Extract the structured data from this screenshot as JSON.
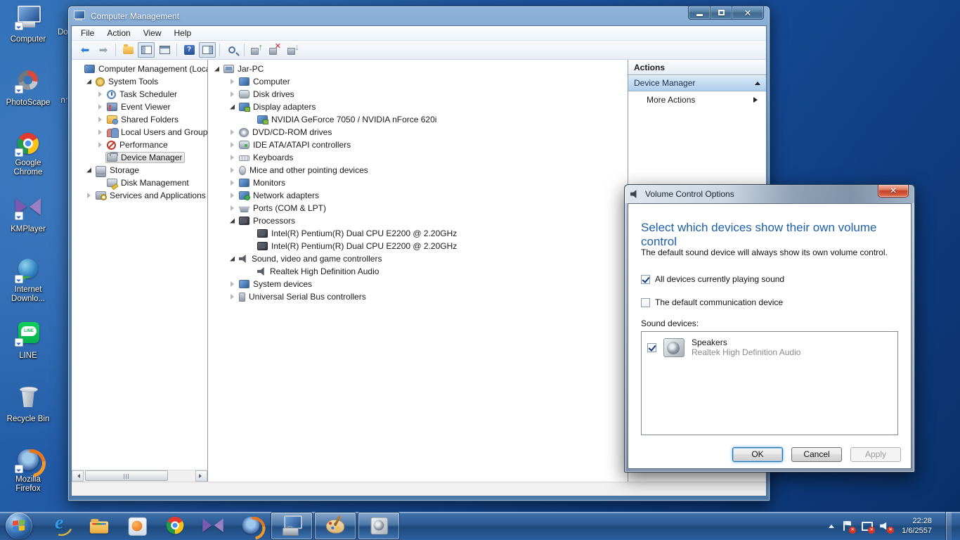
{
  "desktop": {
    "icons": [
      {
        "label": "Computer",
        "icon": "di-computer has-arrow",
        "iconname": "computer-icon",
        "name": "desktop-icon-computer"
      },
      {
        "label": "PhotoScape",
        "icon": "di-photoscape has-arrow",
        "iconname": "photoscape-icon",
        "name": "desktop-icon-photoscape"
      },
      {
        "label": "Google Chrome",
        "icon": "di-chrome has-arrow",
        "iconname": "chrome-icon",
        "name": "desktop-icon-google-chrome"
      },
      {
        "label": "KMPlayer",
        "icon": "di-km has-arrow",
        "iconname": "kmplayer-icon",
        "name": "desktop-icon-kmplayer"
      },
      {
        "label": "Internet Downlo...",
        "icon": "di-idm has-arrow",
        "iconname": "idm-icon",
        "name": "desktop-icon-internet-download-manager"
      },
      {
        "label": "LINE",
        "icon": "di-line has-arrow",
        "iconname": "line-icon",
        "name": "desktop-icon-line"
      },
      {
        "label": "Recycle Bin",
        "icon": "di-recycle",
        "iconname": "recycle-bin-icon",
        "name": "desktop-icon-recycle-bin"
      },
      {
        "label": "Mozilla Firefox",
        "icon": "di-firefox has-arrow",
        "iconname": "firefox-icon",
        "name": "desktop-icon-mozilla-firefox"
      }
    ],
    "partial_labels": {
      "top": "Do",
      "bottom": "กา"
    }
  },
  "window": {
    "title": "Computer Management",
    "menus": [
      {
        "label": "File",
        "name": "menu-file"
      },
      {
        "label": "Action",
        "name": "menu-action"
      },
      {
        "label": "View",
        "name": "menu-view"
      },
      {
        "label": "Help",
        "name": "menu-help"
      }
    ],
    "toolbar": [
      {
        "cls": "tbtn",
        "icon": "tb-back",
        "name": "toolbar-back-button",
        "ia": "true"
      },
      {
        "cls": "tbtn",
        "icon": "tb-fwd",
        "name": "toolbar-forward-button",
        "ia": "true"
      },
      {
        "cls": "tb-sep",
        "name": "toolbar-separator",
        "ia": "false"
      },
      {
        "cls": "tbtn",
        "icon": "tb-folder",
        "name": "toolbar-export-list-button",
        "ia": "true"
      },
      {
        "cls": "tbtn pressed",
        "icon": "tb-winL",
        "name": "toolbar-show-console-tree-button",
        "ia": "true"
      },
      {
        "cls": "tbtn",
        "icon": "tb-props",
        "name": "toolbar-properties-button",
        "ia": "true"
      },
      {
        "cls": "tb-sep",
        "name": "toolbar-separator",
        "ia": "false"
      },
      {
        "cls": "tbtn",
        "icon": "tb-help",
        "name": "toolbar-help-button",
        "ia": "true"
      },
      {
        "cls": "tbtn pressed",
        "icon": "tb-winR",
        "name": "toolbar-show-action-pane-button",
        "ia": "true"
      },
      {
        "cls": "tb-sep",
        "name": "toolbar-separator",
        "ia": "false"
      },
      {
        "cls": "tbtn",
        "icon": "tb-scan",
        "name": "toolbar-scan-hardware-changes-button",
        "ia": "true"
      },
      {
        "cls": "tb-sep",
        "name": "toolbar-separator",
        "ia": "false"
      },
      {
        "cls": "tbtn",
        "icon": "tb-chip tb-up",
        "name": "toolbar-update-driver-button",
        "ia": "true"
      },
      {
        "cls": "tbtn",
        "icon": "tb-chip tb-del",
        "name": "toolbar-uninstall-device-button",
        "ia": "true"
      },
      {
        "cls": "tbtn",
        "icon": "tb-chip tb-dis",
        "name": "toolbar-disable-device-button",
        "ia": "true"
      }
    ],
    "console_tree": [
      {
        "label": "Computer Management (Local",
        "cls": "ind0",
        "arrow": "noarrow",
        "icon": "ic-cmgmt",
        "iconname": "computer-management-icon",
        "name": "tree-item-computer-management"
      },
      {
        "label": "System Tools",
        "cls": "ind1",
        "arrow": "expanded",
        "icon": "ic-systools",
        "iconname": "system-tools-icon",
        "name": "tree-item-system-tools"
      },
      {
        "label": "Task Scheduler",
        "cls": "ind2",
        "arrow": "collapsed",
        "icon": "ic-task",
        "iconname": "task-scheduler-icon",
        "name": "tree-item-task-scheduler"
      },
      {
        "label": "Event Viewer",
        "cls": "ind2",
        "arrow": "collapsed",
        "icon": "ic-event",
        "iconname": "event-viewer-icon",
        "name": "tree-item-event-viewer"
      },
      {
        "label": "Shared Folders",
        "cls": "ind2",
        "arrow": "collapsed",
        "icon": "ic-shared",
        "iconname": "shared-folders-icon",
        "name": "tree-item-shared-folders"
      },
      {
        "label": "Local Users and Groups",
        "cls": "ind2",
        "arrow": "collapsed",
        "icon": "ic-users",
        "iconname": "local-users-groups-icon",
        "name": "tree-item-local-users-and-groups"
      },
      {
        "label": "Performance",
        "cls": "ind2",
        "arrow": "collapsed",
        "icon": "ic-perf",
        "iconname": "performance-icon",
        "name": "tree-item-performance"
      },
      {
        "label": "Device Manager",
        "cls": "ind2 selected",
        "arrow": "noarrow",
        "icon": "ic-devmgr",
        "iconname": "device-manager-icon",
        "name": "tree-item-device-manager"
      },
      {
        "label": "Storage",
        "cls": "ind1",
        "arrow": "expanded",
        "icon": "ic-storage",
        "iconname": "storage-icon",
        "name": "tree-item-storage"
      },
      {
        "label": "Disk Management",
        "cls": "ind2",
        "arrow": "noarrow",
        "icon": "ic-diskmgmt",
        "iconname": "disk-management-icon",
        "name": "tree-item-disk-management"
      },
      {
        "label": "Services and Applications",
        "cls": "ind1",
        "arrow": "collapsed",
        "icon": "ic-services",
        "iconname": "services-applications-icon",
        "name": "tree-item-services-and-applications"
      }
    ],
    "device_tree": [
      {
        "label": "Jar-PC",
        "cls": "ind0",
        "arrow": "expanded",
        "icon": "ic-pcroot",
        "iconname": "computer-root-icon",
        "name": "device-item-jar-pc"
      },
      {
        "label": "Computer",
        "cls": "ind1",
        "arrow": "collapsed",
        "icon": "ic-computer",
        "iconname": "computer-category-icon",
        "name": "device-item-computer"
      },
      {
        "label": "Disk drives",
        "cls": "ind1",
        "arrow": "collapsed",
        "icon": "ic-disk",
        "iconname": "disk-drives-icon",
        "name": "device-item-disk-drives"
      },
      {
        "label": "Display adapters",
        "cls": "ind1",
        "arrow": "expanded",
        "icon": "ic-display",
        "iconname": "display-adapters-icon",
        "name": "device-item-display-adapters"
      },
      {
        "label": "NVIDIA GeForce 7050 / NVIDIA nForce 620i",
        "cls": "ind2",
        "arrow": "noarrow",
        "icon": "ic-display",
        "iconname": "display-adapter-icon",
        "name": "device-item-nvidia-geforce-7050"
      },
      {
        "label": "DVD/CD-ROM drives",
        "cls": "ind1",
        "arrow": "collapsed",
        "icon": "ic-dvd",
        "iconname": "dvd-cdrom-icon",
        "name": "device-item-dvd-cd-rom-drives"
      },
      {
        "label": "IDE ATA/ATAPI controllers",
        "cls": "ind1",
        "arrow": "collapsed",
        "icon": "ic-ide",
        "iconname": "ide-controllers-icon",
        "name": "device-item-ide-ata-atapi-controllers"
      },
      {
        "label": "Keyboards",
        "cls": "ind1",
        "arrow": "collapsed",
        "icon": "ic-keyboard",
        "iconname": "keyboards-icon",
        "name": "device-item-keyboards"
      },
      {
        "label": "Mice and other pointing devices",
        "cls": "ind1",
        "arrow": "collapsed",
        "icon": "ic-mouse",
        "iconname": "mice-icon",
        "name": "device-item-mice"
      },
      {
        "label": "Monitors",
        "cls": "ind1",
        "arrow": "collapsed",
        "icon": "ic-monitor",
        "iconname": "monitors-icon",
        "name": "device-item-monitors"
      },
      {
        "label": "Network adapters",
        "cls": "ind1",
        "arrow": "collapsed",
        "icon": "ic-network",
        "iconname": "network-adapters-icon",
        "name": "device-item-network-adapters"
      },
      {
        "label": "Ports (COM & LPT)",
        "cls": "ind1",
        "arrow": "collapsed",
        "icon": "ic-ports",
        "iconname": "ports-icon",
        "name": "device-item-ports"
      },
      {
        "label": "Processors",
        "cls": "ind1",
        "arrow": "expanded",
        "icon": "ic-cpu",
        "iconname": "processors-icon",
        "name": "device-item-processors"
      },
      {
        "label": "Intel(R) Pentium(R) Dual  CPU  E2200  @ 2.20GHz",
        "cls": "ind2",
        "arrow": "noarrow",
        "icon": "ic-cpu",
        "iconname": "processor-icon",
        "name": "device-item-intel-pentium-e2200-1"
      },
      {
        "label": "Intel(R) Pentium(R) Dual  CPU  E2200  @ 2.20GHz",
        "cls": "ind2",
        "arrow": "noarrow",
        "icon": "ic-cpu",
        "iconname": "processor-icon",
        "name": "device-item-intel-pentium-e2200-2"
      },
      {
        "label": "Sound, video and game controllers",
        "cls": "ind1",
        "arrow": "expanded",
        "icon": "ic-sound",
        "iconname": "sound-controllers-icon",
        "name": "device-item-sound-video-game-controllers"
      },
      {
        "label": "Realtek High Definition Audio",
        "cls": "ind2",
        "arrow": "noarrow",
        "icon": "ic-sound",
        "iconname": "audio-device-icon",
        "name": "device-item-realtek-hd-audio"
      },
      {
        "label": "System devices",
        "cls": "ind1",
        "arrow": "collapsed",
        "icon": "ic-sysdev",
        "iconname": "system-devices-icon",
        "name": "device-item-system-devices"
      },
      {
        "label": "Universal Serial Bus controllers",
        "cls": "ind1",
        "arrow": "collapsed",
        "icon": "ic-usb",
        "iconname": "usb-controllers-icon",
        "name": "device-item-usb-controllers"
      }
    ],
    "actions": {
      "header": "Actions",
      "section": "Device Manager",
      "more": "More Actions"
    }
  },
  "dialog": {
    "title": "Volume Control Options",
    "heading": "Select which devices show their own volume control",
    "description": "The default sound device will always show its own volume control.",
    "checkbox_all": "All devices currently playing sound",
    "checkbox_default": "The default communication device",
    "sound_devices_label": "Sound devices:",
    "device": {
      "name": "Speakers",
      "subtitle": "Realtek High Definition Audio"
    },
    "buttons": {
      "ok": "OK",
      "cancel": "Cancel",
      "apply": "Apply"
    }
  },
  "taskbar": {
    "buttons": [
      {
        "cls": "",
        "icon": "di-ie",
        "iconname": "internet-explorer-icon",
        "name": "taskbar-internet-explorer"
      },
      {
        "cls": "",
        "icon": "di-explorer",
        "iconname": "windows-explorer-icon",
        "name": "taskbar-windows-explorer"
      },
      {
        "cls": "",
        "icon": "di-wmp",
        "iconname": "media-player-icon",
        "name": "taskbar-windows-media-player"
      },
      {
        "cls": "",
        "icon": "di-chrome",
        "iconname": "chrome-icon",
        "name": "taskbar-google-chrome"
      },
      {
        "cls": "",
        "icon": "di-km",
        "iconname": "kmplayer-icon",
        "name": "taskbar-kmplayer"
      },
      {
        "cls": "",
        "icon": "di-firefox",
        "iconname": "firefox-icon",
        "name": "taskbar-firefox"
      },
      {
        "cls": "active",
        "icon": "di-cmgmt",
        "iconname": "computer-management-icon",
        "name": "taskbar-computer-management"
      },
      {
        "cls": "active",
        "icon": "di-paint",
        "iconname": "paint-icon",
        "name": "taskbar-paint"
      },
      {
        "cls": "active",
        "icon": "di-volume",
        "iconname": "volume-mixer-icon",
        "name": "taskbar-volume-control"
      }
    ],
    "tray": {
      "time": "22:28",
      "date": "1/6/2557"
    }
  }
}
